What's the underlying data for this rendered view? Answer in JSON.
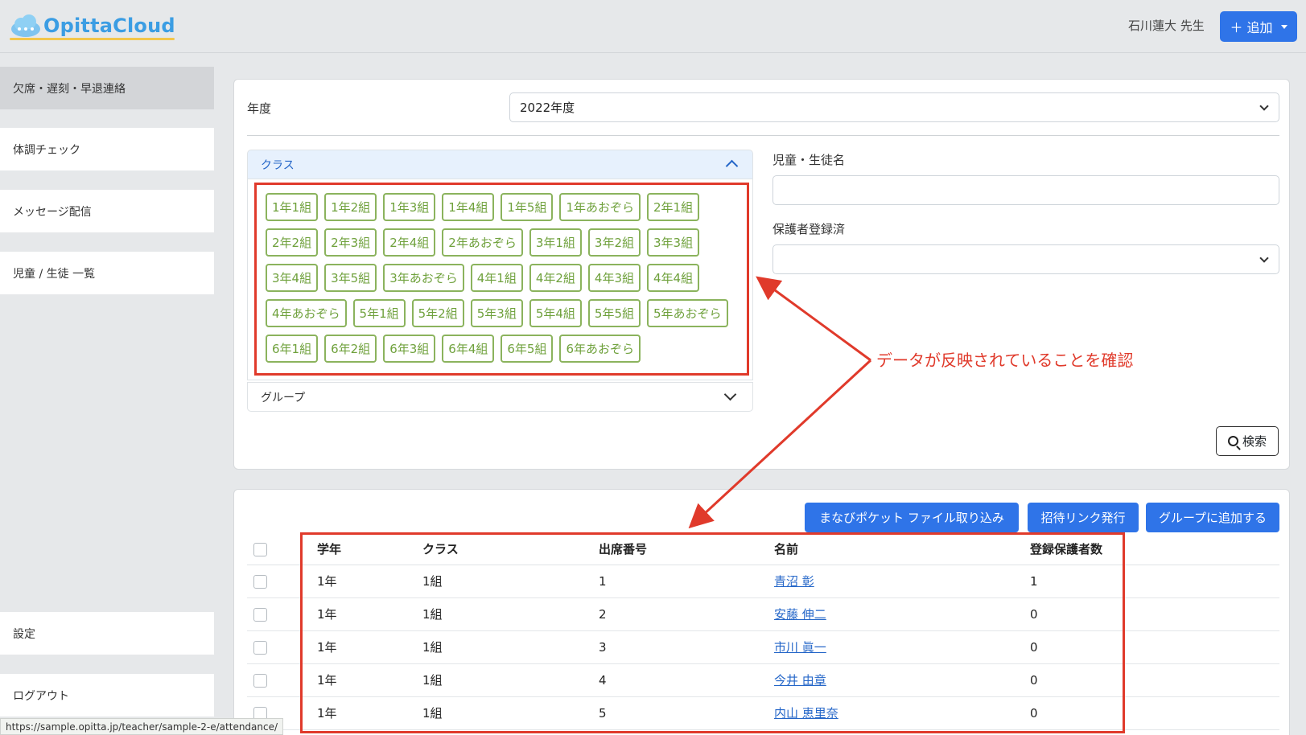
{
  "header": {
    "logo_text": "OpittaCloud",
    "teacher_name": "石川蓮大 先生",
    "add_button": "＋ 追加"
  },
  "sidebar": {
    "items": [
      {
        "label": "欠席・遅刻・早退連絡",
        "active": true
      },
      {
        "label": "体調チェック"
      },
      {
        "label": "メッセージ配信"
      },
      {
        "label": "児童 / 生徒 一覧"
      },
      {
        "label": "設定"
      },
      {
        "label": "ログアウト"
      }
    ]
  },
  "filters": {
    "year_label": "年度",
    "year_value": "2022年度",
    "class_header": "クラス",
    "group_header": "グループ",
    "name_label": "児童・生徒名",
    "name_value": "",
    "guardian_label": "保護者登録済",
    "guardian_value": "",
    "search_button": "検索",
    "class_chips": [
      [
        "1年1組",
        "1年2組",
        "1年3組",
        "1年4組",
        "1年5組",
        "1年あおぞら",
        "2年1組"
      ],
      [
        "2年2組",
        "2年3組",
        "2年4組",
        "2年あおぞら",
        "3年1組",
        "3年2組",
        "3年3組"
      ],
      [
        "3年4組",
        "3年5組",
        "3年あおぞら",
        "4年1組",
        "4年2組",
        "4年3組",
        "4年4組"
      ],
      [
        "4年あおぞら",
        "5年1組",
        "5年2組",
        "5年3組",
        "5年4組",
        "5年5組",
        "5年あおぞら"
      ],
      [
        "6年1組",
        "6年2組",
        "6年3組",
        "6年4組",
        "6年5組",
        "6年あおぞら"
      ]
    ]
  },
  "annotation": "データが反映されていることを確認",
  "actions": {
    "import_button": "まなびポケット ファイル取り込み",
    "invite_button": "招待リンク発行",
    "group_button": "グループに追加する"
  },
  "table": {
    "columns": [
      "学年",
      "クラス",
      "出席番号",
      "名前",
      "登録保護者数"
    ],
    "rows": [
      [
        "1年",
        "1組",
        "1",
        "青沼 彰",
        "1"
      ],
      [
        "1年",
        "1組",
        "2",
        "安藤 伸二",
        "0"
      ],
      [
        "1年",
        "1組",
        "3",
        "市川 眞一",
        "0"
      ],
      [
        "1年",
        "1組",
        "4",
        "今井 由章",
        "0"
      ],
      [
        "1年",
        "1組",
        "5",
        "内山 恵里奈",
        "0"
      ]
    ]
  },
  "status_url": "https://sample.opitta.jp/teacher/sample-2-e/attendance/",
  "colors": {
    "primary": "#2f74e8",
    "chip_green": "#6fa13c",
    "annotation_red": "#e03a2b"
  }
}
